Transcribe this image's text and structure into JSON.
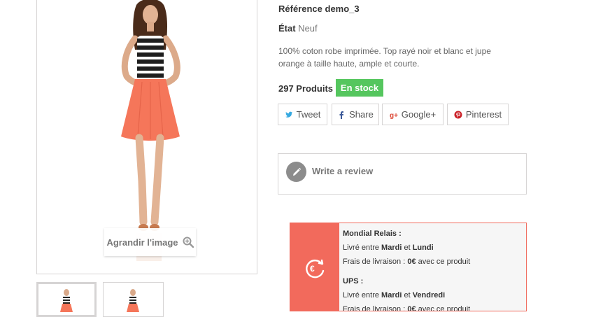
{
  "product": {
    "zoom_label": "Agrandir l'image",
    "reference_label": "Référence",
    "reference_value": "demo_3",
    "condition_label": "État",
    "condition_value": "Neuf",
    "description": "100% coton robe imprimée. Top rayé noir et blanc et jupe orange à taille haute, ample et courte.",
    "quantity_text": "297 Produits",
    "stock_badge": "En stock"
  },
  "share": {
    "tweet": "Tweet",
    "share": "Share",
    "google": "Google+",
    "pinterest": "Pinterest"
  },
  "review": {
    "label": "Write a review"
  },
  "shipping": {
    "carrier1": {
      "name": "Mondial Relais :",
      "delivery_prefix": "Livré entre",
      "day_from": "Mardi",
      "and": "et",
      "day_to": "Lundi",
      "fee_prefix": "Frais de livraison :",
      "fee_value": "0€",
      "fee_suffix": "avec ce produit"
    },
    "carrier2": {
      "name": "UPS :",
      "delivery_prefix": "Livré entre",
      "day_from": "Mardi",
      "and": "et",
      "day_to": "Vendredi",
      "fee_prefix": "Frais de livraison :",
      "fee_value": "0€",
      "fee_suffix": "avec ce produit"
    }
  },
  "colors": {
    "stock_green": "#55c65e",
    "shipping_red": "#f26a5c",
    "border": "#d6d4d4"
  }
}
